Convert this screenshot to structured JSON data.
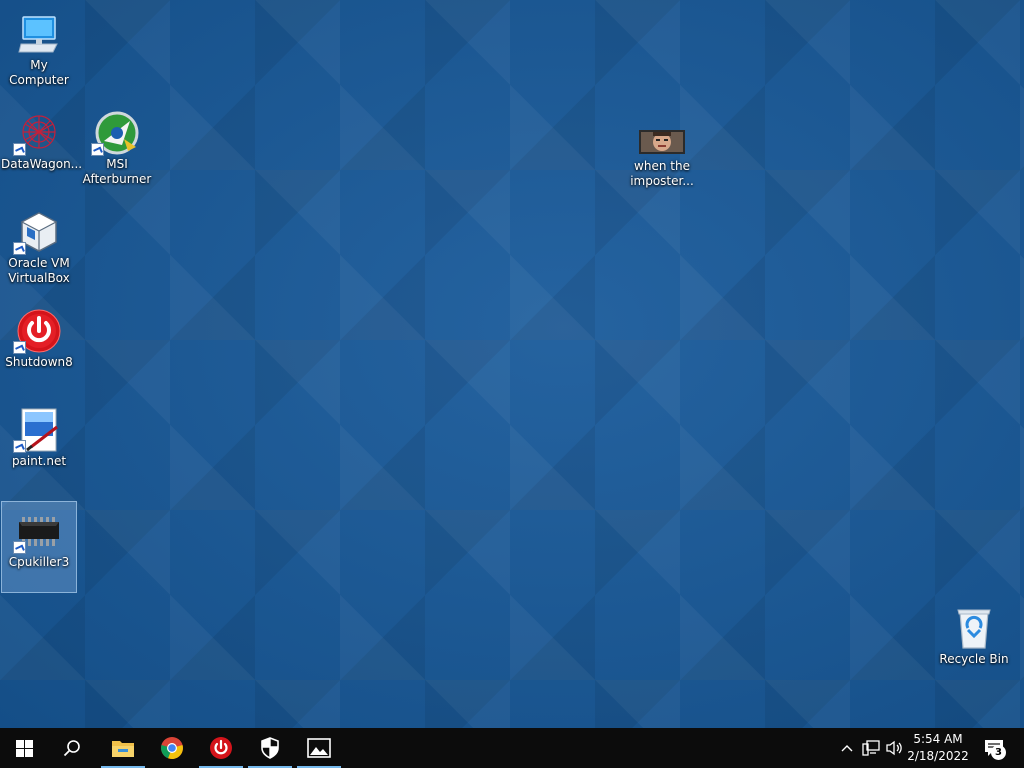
{
  "desktop": {
    "icons": {
      "my_computer": "My Computer",
      "datawagon": "DataWagon...",
      "msi": "MSI Afterburner",
      "virtualbox": "Oracle VM VirtualBox",
      "shutdown8": "Shutdown8",
      "paintnet": "paint.net",
      "cpukiller": "Cpukiller3",
      "imposter": "when the imposter...",
      "recycle_bin": "Recycle Bin"
    },
    "selected_icon": "Cpukiller3"
  },
  "taskbar": {
    "start_icon": "windows-logo",
    "search_icon": "magnifier",
    "pinned": [
      "File Explorer",
      "Google Chrome",
      "Shutdown8",
      "Windows Security",
      "Photos"
    ],
    "tray": {
      "time": "5:54 AM",
      "date": "2/18/2022",
      "notification_count": "3"
    }
  },
  "colors": {
    "desktop_bg": "#17599a",
    "taskbar_bg": "#0c0c0c",
    "running_indicator": "#76b9ed"
  }
}
